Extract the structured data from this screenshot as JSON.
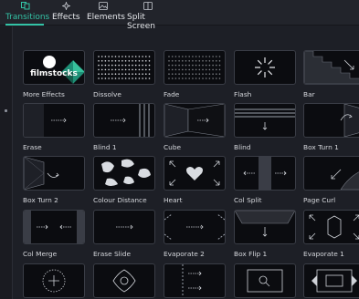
{
  "tabs": [
    {
      "label": "Transitions",
      "icon": "transitions-icon",
      "active": true
    },
    {
      "label": "Effects",
      "icon": "effects-icon",
      "active": false
    },
    {
      "label": "Elements",
      "icon": "elements-icon",
      "active": false
    },
    {
      "label": "Split Screen",
      "icon": "split-screen-icon",
      "active": false
    }
  ],
  "accent_color": "#33c3a6",
  "items": [
    {
      "label": "More Effects",
      "thumb": "filmstocks",
      "brand": "filmstocks"
    },
    {
      "label": "Dissolve",
      "thumb": "dots"
    },
    {
      "label": "Fade",
      "thumb": "dots-dim"
    },
    {
      "label": "Flash",
      "thumb": "burst"
    },
    {
      "label": "Bar",
      "thumb": "stairs"
    },
    {
      "label": "Erase",
      "thumb": "erase"
    },
    {
      "label": "Blind 1",
      "thumb": "blind1"
    },
    {
      "label": "Cube",
      "thumb": "cube"
    },
    {
      "label": "Blind",
      "thumb": "blind"
    },
    {
      "label": "Box Turn 1",
      "thumb": "boxturn1"
    },
    {
      "label": "Box Turn 2",
      "thumb": "boxturn2"
    },
    {
      "label": "Colour Distance",
      "thumb": "blobs"
    },
    {
      "label": "Heart",
      "thumb": "heart"
    },
    {
      "label": "Col Split",
      "thumb": "colsplit"
    },
    {
      "label": "Page Curl",
      "thumb": "pagecurl"
    },
    {
      "label": "Col Merge",
      "thumb": "colmerge"
    },
    {
      "label": "Erase Slide",
      "thumb": "eraseslide"
    },
    {
      "label": "Evaporate 2",
      "thumb": "evaporate2"
    },
    {
      "label": "Box Flip 1",
      "thumb": "boxflip1"
    },
    {
      "label": "Evaporate 1",
      "thumb": "evaporate1"
    },
    {
      "label": "",
      "thumb": "circle-dots"
    },
    {
      "label": "",
      "thumb": "flower"
    },
    {
      "label": "",
      "thumb": "arrows-strip"
    },
    {
      "label": "",
      "thumb": "magnify"
    },
    {
      "label": "",
      "thumb": "frame-ornate"
    }
  ]
}
